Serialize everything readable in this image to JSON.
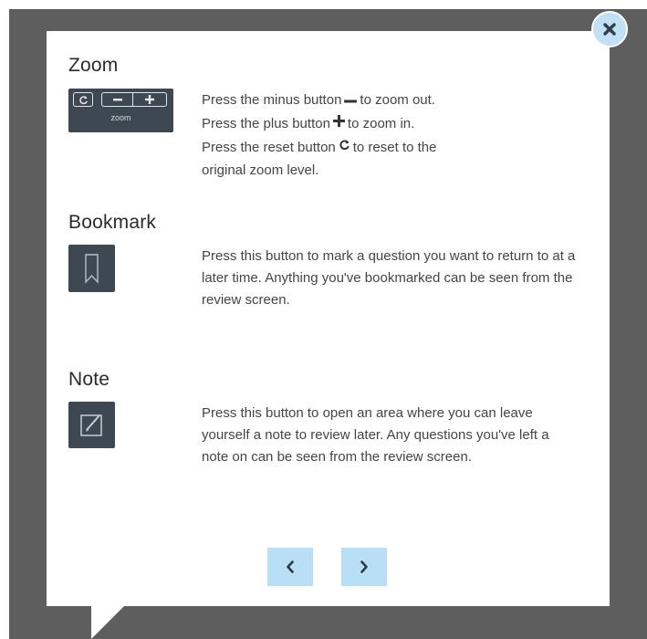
{
  "dialog": {
    "close_icon": "close-icon",
    "accent_color": "#b9dff6",
    "icon_bg_color": "#3d4852"
  },
  "sections": {
    "zoom": {
      "title": "Zoom",
      "widget_label": "zoom",
      "line1_pre": "Press the minus button",
      "line1_post": "to zoom out.",
      "line2_pre": "Press the plus button",
      "line2_post": "to zoom in.",
      "line3_pre": "Press the reset button",
      "line3_post": "to reset to the",
      "line4": "original zoom level."
    },
    "bookmark": {
      "title": "Bookmark",
      "icon": "bookmark-icon",
      "text": "Press this button to mark a question you want to return to at a later time. Anything you've bookmarked can be seen from the review screen."
    },
    "note": {
      "title": "Note",
      "icon": "note-icon",
      "text": "Press this button to open an area where you can leave yourself a note to review later. Any questions you've left a note on can be seen from the review screen."
    }
  },
  "navigation": {
    "prev_icon": "chevron-left-icon",
    "next_icon": "chevron-right-icon"
  }
}
